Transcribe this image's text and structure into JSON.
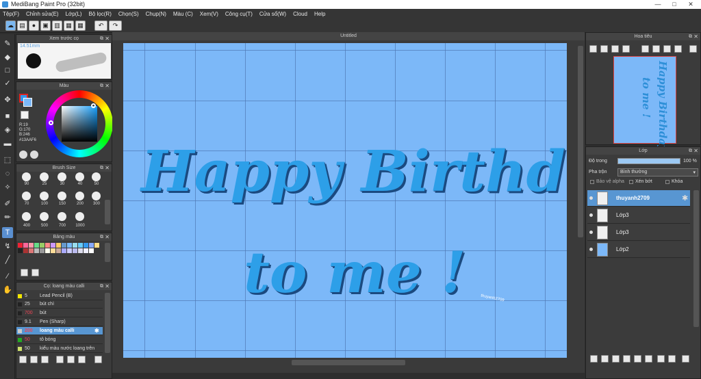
{
  "window": {
    "title": "MediBang Paint Pro (32bit)",
    "minimize": "—",
    "maximize": "□",
    "close": "✕"
  },
  "menu": [
    "Tệp(F)",
    "Chỉnh sửa(E)",
    "Lớp(L)",
    "Bộ lọc(R)",
    "Chọn(S)",
    "Chụp(N)",
    "Màu (C)",
    "Xem(V)",
    "Công cụ(T)",
    "Cửa sổ(W)",
    "Cloud",
    "Help"
  ],
  "brush_preview": {
    "title": "Xem trước cọ",
    "size": "14.51mm"
  },
  "color_panel": {
    "title": "Màu",
    "r": "R:19",
    "g": "G:170",
    "b": "B:246",
    "hex": "#13AAF6"
  },
  "brush_size": {
    "title": "Brush Size",
    "sizes": [
      "90",
      "25",
      "30",
      "40",
      "50",
      "70",
      "100",
      "150",
      "200",
      "300",
      "400",
      "500",
      "700",
      "1000"
    ]
  },
  "palette_panel": {
    "title": "Bảng màu"
  },
  "brush_list": {
    "title": "Cọ: loang màu calli",
    "items": [
      {
        "size": "5",
        "name": "Lead Pencil (B)",
        "color": "#f2e600"
      },
      {
        "size": "25",
        "name": "bút chì",
        "color": "#222222"
      },
      {
        "size": "700",
        "name": "bút",
        "color": "#222222"
      },
      {
        "size": "9.1",
        "name": "Pen (Sharp)",
        "color": "#222222"
      },
      {
        "size": "200",
        "name": "loang màu calli",
        "color": "#cccccc"
      },
      {
        "size": "50",
        "name": "tô bóng",
        "color": "#22aa22"
      },
      {
        "size": "50",
        "name": "kiểu màu nước loang trên",
        "color": "#cce06a"
      }
    ]
  },
  "document": {
    "tab": "Untitled",
    "line1": "Happy Birthday",
    "line2": "to me !",
    "watermark": "thuyanh2709"
  },
  "navigator": {
    "title": "Hoa tiêu"
  },
  "layers": {
    "title": "Lớp",
    "opacity_label": "Độ trong",
    "opacity_value": "100 %",
    "opacity_fraction": 1.0,
    "blend_label": "Pha trộn",
    "blend_value": "Bình thường",
    "protect_alpha": "Bảo vệ alpha",
    "clipping": "Xén bớt",
    "lock": "Khóa",
    "items": [
      {
        "name": "thuyanh2709",
        "selected": true
      },
      {
        "name": "Lớp3",
        "selected": false
      },
      {
        "name": "Lớp3",
        "selected": false
      },
      {
        "name": "Lớp2",
        "selected": false
      }
    ]
  }
}
